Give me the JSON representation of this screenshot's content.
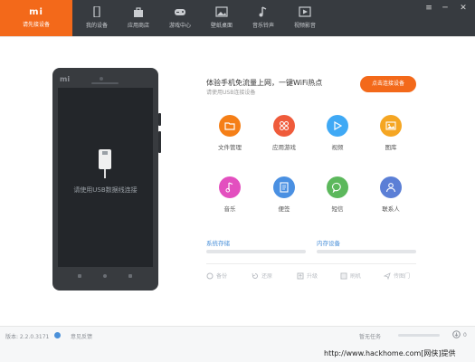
{
  "brand": {
    "logo": "mi",
    "subtitle": "请先接设备"
  },
  "tabs": [
    {
      "label": "我的设备",
      "icon": "phone-icon"
    },
    {
      "label": "应用商店",
      "icon": "shopping-bag-icon"
    },
    {
      "label": "游戏中心",
      "icon": "gamepad-icon"
    },
    {
      "label": "壁纸桌面",
      "icon": "image-icon"
    },
    {
      "label": "音乐铃声",
      "icon": "music-note-icon"
    },
    {
      "label": "视频影音",
      "icon": "video-icon"
    }
  ],
  "window": {
    "menu": "≡",
    "minimize": "─",
    "close": "✕"
  },
  "phone": {
    "brand": "mi",
    "message": "请使用USB数据线连接"
  },
  "promo": {
    "headline": "体验手机免流量上网，一键WiFi热点",
    "subline": "请使用USB连接设备",
    "button": "点击连接设备"
  },
  "apps": [
    {
      "label": "文件管理",
      "icon": "folder-icon",
      "color": "#f57f17"
    },
    {
      "label": "应用游戏",
      "icon": "apps-grid-icon",
      "color": "#ef5b3b"
    },
    {
      "label": "视频",
      "icon": "play-icon",
      "color": "#3fa9f5"
    },
    {
      "label": "图库",
      "icon": "picture-icon",
      "color": "#f5a623"
    },
    {
      "label": "音乐",
      "icon": "music-icon",
      "color": "#e34fbf"
    },
    {
      "label": "便签",
      "icon": "note-icon",
      "color": "#4a90e2"
    },
    {
      "label": "短信",
      "icon": "message-icon",
      "color": "#5cb85c"
    },
    {
      "label": "联系人",
      "icon": "contact-icon",
      "color": "#5b7fd6"
    }
  ],
  "storage": {
    "system": "系统存储",
    "internal": "内存设备"
  },
  "actions": [
    {
      "label": "备份",
      "icon": "backup-icon"
    },
    {
      "label": "还原",
      "icon": "restore-icon"
    },
    {
      "label": "升级",
      "icon": "upgrade-icon"
    },
    {
      "label": "刷机",
      "icon": "flash-icon"
    },
    {
      "label": "传图门",
      "icon": "send-icon"
    }
  ],
  "status": {
    "version": "版本: 2.2.0.3171",
    "feedback": "意见反馈",
    "tasks": "暂无任务",
    "count": "0"
  },
  "watermark": "http://www.hackhome.com[网侠]提供",
  "colors": {
    "accent": "#f3691a",
    "topbar": "#373b40",
    "link": "#4a90d9"
  }
}
